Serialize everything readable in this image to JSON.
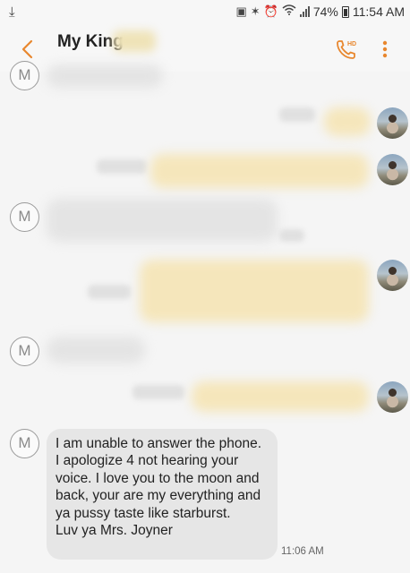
{
  "status_bar": {
    "left_icon": "download-icon",
    "icons": [
      "sim-icon",
      "bluetooth-icon",
      "alarm-icon",
      "wifi-icon",
      "signal-icon",
      "battery-icon"
    ],
    "battery": "74%",
    "time": "11:54 AM"
  },
  "header": {
    "contact_name": "My King",
    "back_icon": "chevron-left-icon",
    "call_icon": "hd-call-icon",
    "more_icon": "more-vert-icon",
    "accent_color": "#e8872e"
  },
  "avatar": {
    "incoming_initial": "M"
  },
  "messages": {
    "last_incoming": {
      "text": "I am unable to answer the phone. I apologize 4 not hearing your voice. I love you to the moon and back, your are my everything and ya pussy taste like starburst.\nLuv ya Mrs. Joyner",
      "time": "11:06 AM"
    }
  },
  "colors": {
    "incoming_bubble": "#e6e6e6",
    "outgoing_bubble": "#f6ecc8",
    "background": "#f5f5f5"
  }
}
